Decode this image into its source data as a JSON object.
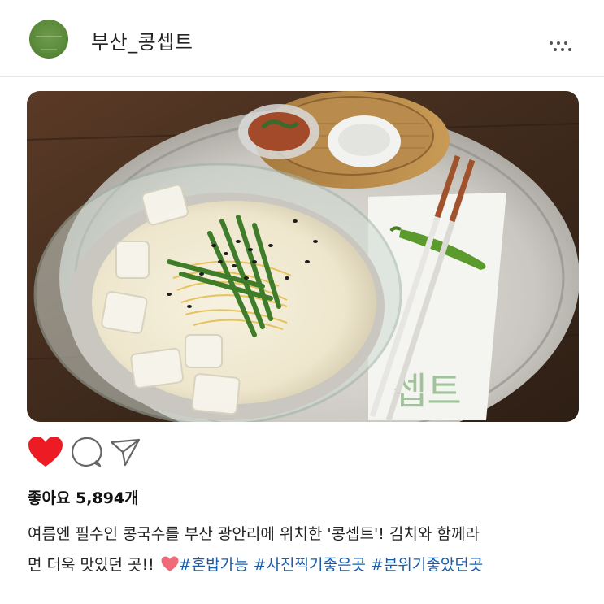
{
  "post": {
    "username": "부산_콩셉트",
    "more_label": "⋮"
  },
  "photo": {
    "alt": "콩국수",
    "napkin_text": "셉트"
  },
  "actions": {
    "liked": true,
    "like_color": "#ed1c24",
    "icons": [
      "heart-icon",
      "comment-icon",
      "send-icon"
    ]
  },
  "likes": {
    "text": "좋아요 5,894개"
  },
  "caption": {
    "line1": "여름엔 필수인 콩국수를 부산 광안리에 위치한 '콩셉트'! 김치와 함께라",
    "line2_prefix": "면 더욱 맛있던 곳!! ",
    "hashtags": [
      "#혼밥가능",
      "#사진찍기좋은곳",
      "#분위기좋았던곳"
    ]
  },
  "colors": {
    "hashtag": "#1a5dab",
    "accent_heart": "#ed1c24"
  }
}
